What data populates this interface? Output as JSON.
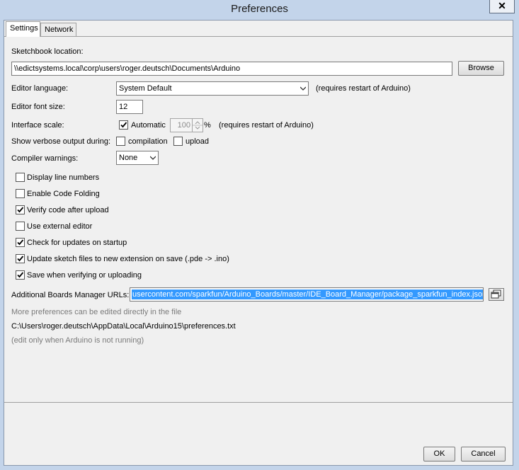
{
  "window": {
    "title": "Preferences",
    "close_glyph": "✕"
  },
  "tabs": [
    {
      "label": "Settings"
    },
    {
      "label": "Network"
    }
  ],
  "settings": {
    "sketchbook": {
      "label": "Sketchbook location:",
      "value": "\\\\edictsystems.local\\corp\\users\\roger.deutsch\\Documents\\Arduino",
      "browse": "Browse"
    },
    "editor_language": {
      "label": "Editor language:",
      "value": "System Default",
      "note": "(requires restart of Arduino)"
    },
    "font_size": {
      "label": "Editor font size:",
      "value": "12"
    },
    "interface_scale": {
      "label": "Interface scale:",
      "automatic_label": "Automatic",
      "automatic_checked": true,
      "value": "100",
      "unit": "%",
      "note": "(requires restart of Arduino)"
    },
    "verbose": {
      "label": "Show verbose output during:",
      "compilation_label": "compilation",
      "compilation_checked": false,
      "upload_label": "upload",
      "upload_checked": false
    },
    "compiler_warnings": {
      "label": "Compiler warnings:",
      "value": "None"
    },
    "options": [
      {
        "label": "Display line numbers",
        "checked": false
      },
      {
        "label": "Enable Code Folding",
        "checked": false
      },
      {
        "label": "Verify code after upload",
        "checked": true
      },
      {
        "label": "Use external editor",
        "checked": false
      },
      {
        "label": "Check for updates on startup",
        "checked": true
      },
      {
        "label": "Update sketch files to new extension on save (.pde -> .ino)",
        "checked": true
      },
      {
        "label": "Save when verifying or uploading",
        "checked": true
      }
    ],
    "boards_urls": {
      "label": "Additional Boards Manager URLs:",
      "value": "usercontent.com/sparkfun/Arduino_Boards/master/IDE_Board_Manager/package_sparkfun_index.json"
    },
    "more_info": "More preferences can be edited directly in the file",
    "prefs_path": "C:\\Users\\roger.deutsch\\AppData\\Local\\Arduino15\\preferences.txt",
    "edit_note": "(edit only when Arduino is not running)"
  },
  "footer": {
    "ok": "OK",
    "cancel": "Cancel"
  }
}
